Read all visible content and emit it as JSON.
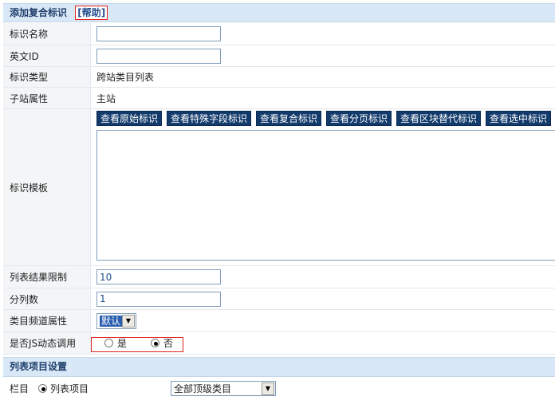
{
  "form_header": {
    "title": "添加复合标识",
    "help": "[帮助]"
  },
  "fields": {
    "name_label": "标识名称",
    "name_value": "",
    "en_id_label": "英文ID",
    "en_id_value": "",
    "type_label": "标识类型",
    "type_value": "跨站类目列表",
    "site_attr_label": "子站属性",
    "site_attr_value": "主站",
    "template_label": "标识模板",
    "template_buttons": [
      "查看原始标识",
      "查看特殊字段标识",
      "查看复合标识",
      "查看分页标识",
      "查看区块替代标识",
      "查看选中标识"
    ],
    "template_value": "",
    "limit_label": "列表结果限制",
    "limit_value": "10",
    "columns_label": "分列数",
    "columns_value": "1",
    "channel_attr_label": "类目频道属性",
    "channel_attr_selected": "默认",
    "js_label": "是否JS动态调用",
    "js_options": [
      "是",
      "否"
    ],
    "js_selected": "否"
  },
  "list_section": {
    "title": "列表项目设置",
    "column_label": "栏目",
    "radio_label": "列表项目",
    "column_select": "全部顶级类目"
  }
}
